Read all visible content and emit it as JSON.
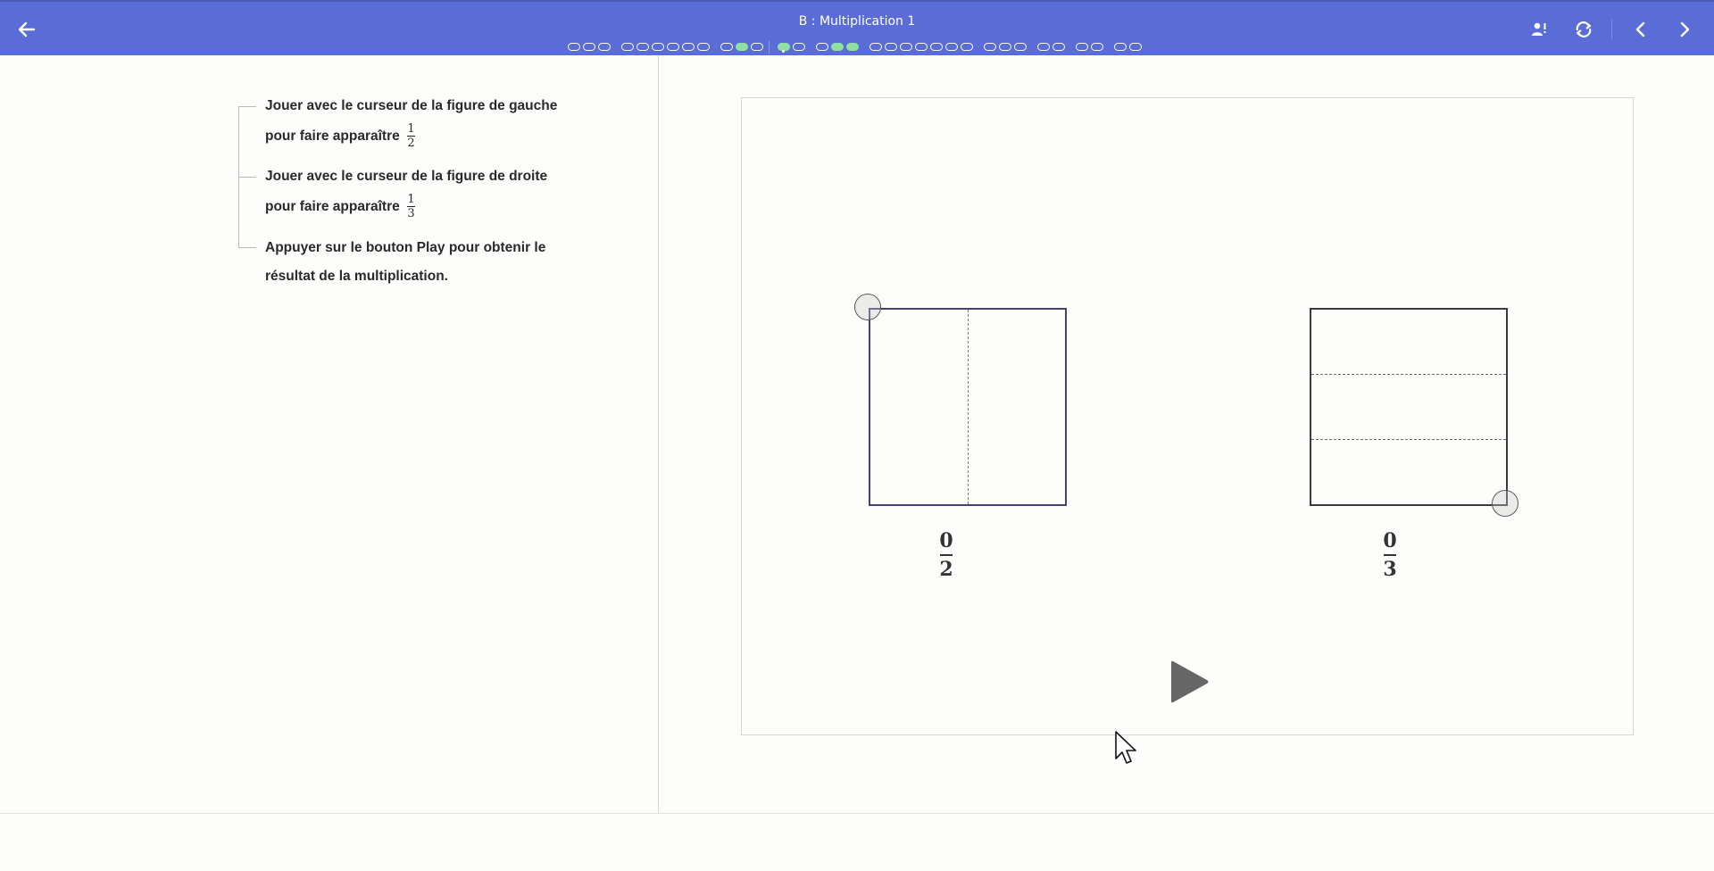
{
  "header": {
    "title": "B : Multiplication 1",
    "icons": {
      "back": "arrow-left-icon",
      "user": "user-alert-icon",
      "refresh": "refresh-icon",
      "prev": "chevron-left-icon",
      "next": "chevron-right-icon"
    },
    "progress_status": [
      [
        "todo",
        "todo",
        "todo"
      ],
      [
        "todo",
        "todo",
        "todo",
        "todo",
        "todo",
        "todo"
      ],
      [
        "todo",
        "done",
        "todo"
      ],
      [
        "current",
        "todo"
      ],
      [
        "todo",
        "done",
        "done"
      ],
      [
        "todo",
        "todo",
        "todo",
        "todo",
        "todo",
        "todo",
        "todo"
      ],
      [
        "todo",
        "todo",
        "todo"
      ],
      [
        "todo",
        "todo"
      ],
      [
        "todo",
        "todo"
      ],
      [
        "todo",
        "todo"
      ]
    ]
  },
  "instructions": {
    "step1_text": "Jouer avec le curseur de la figure de gauche pour faire apparaître",
    "step1_frac_num": "1",
    "step1_frac_den": "2",
    "step2_text": "Jouer avec le curseur de la figure de droite pour faire apparaître",
    "step2_frac_num": "1",
    "step2_frac_den": "3",
    "step3_text": "Appuyer sur le bouton Play pour obtenir le résultat de la multiplication."
  },
  "activity": {
    "left_figure": {
      "numerator": "0",
      "denominator": "2"
    },
    "right_figure": {
      "numerator": "0",
      "denominator": "3"
    },
    "play_icon": "play-icon"
  },
  "colors": {
    "header_bg": "#5a6cd6",
    "done_pill": "#8fe0a2",
    "left_square_border": "#45406e"
  }
}
